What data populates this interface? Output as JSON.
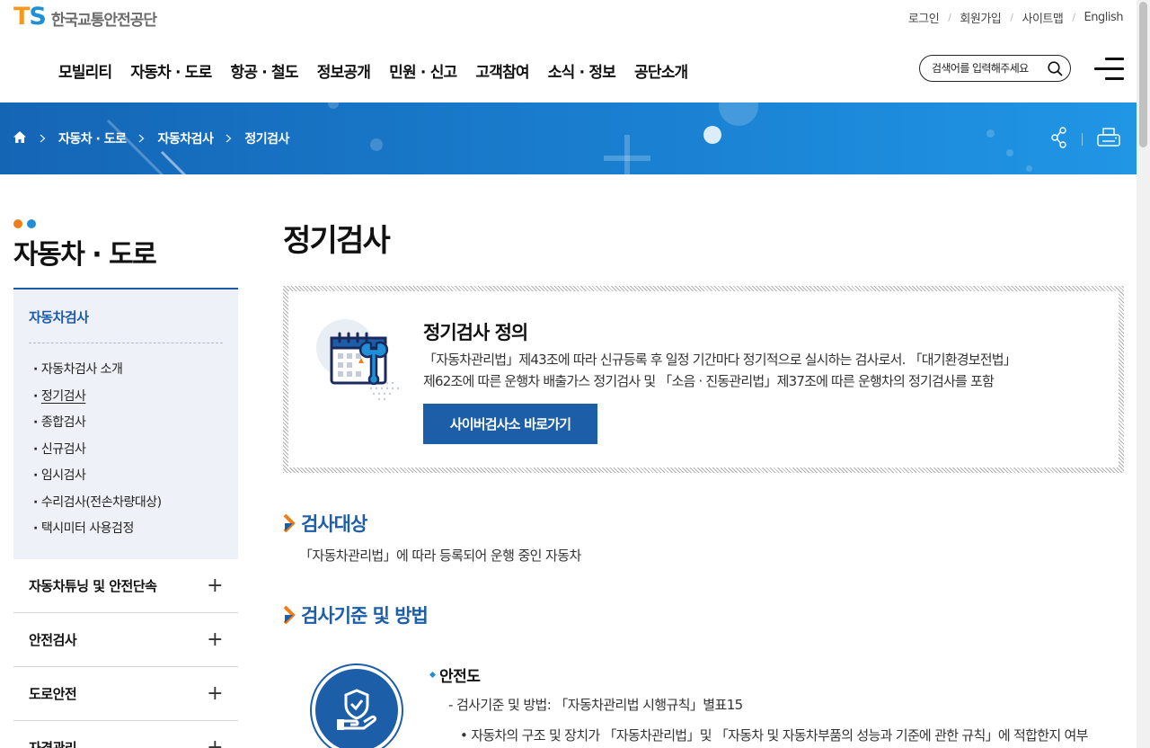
{
  "header": {
    "logo_mark_t": "T",
    "logo_mark_s": "S",
    "logo_text": "한국교통안전공단",
    "util_links": [
      "로그인",
      "회원가입",
      "사이트맵",
      "English"
    ],
    "gnb": [
      "모빌리티",
      "자동차 · 도로",
      "항공 · 철도",
      "정보공개",
      "민원 · 신고",
      "고객참여",
      "소식 · 정보",
      "공단소개"
    ],
    "search_placeholder": "검색어를 입력해주세요"
  },
  "breadcrumb": {
    "items": [
      "자동차 · 도로",
      "자동차검사",
      "정기검사"
    ]
  },
  "sidebar": {
    "title": "자동차 · 도로",
    "section": "자동차검사",
    "sub_items": [
      "자동차검사 소개",
      "정기검사",
      "종합검사",
      "신규검사",
      "임시검사",
      "수리검사(전손차량대상)",
      "택시미터 사용검정"
    ],
    "active_index": 1,
    "menu": [
      "자동차튜닝 및 안전단속",
      "안전검사",
      "도로안전",
      "자격관리"
    ]
  },
  "content": {
    "page_title": "정기검사",
    "definition": {
      "title": "정기검사 정의",
      "desc_line1": "「자동차관리법」제43조에 따라 신규등록 후 일정 기간마다 정기적으로 실시하는 검사로서. 「대기환경보전법」",
      "desc_line2": "제62조에 따른 운행차 배출가스 정기검사 및 「소음 · 진동관리법」제37조에 따른 운행차의 정기검사를 포함",
      "button": "사이버검사소 바로가기"
    },
    "target": {
      "heading": "검사대상",
      "text": "「자동차관리법」에 따라 등록되어 운행 중인 자동차"
    },
    "standard": {
      "heading": "검사기준 및 방법",
      "sub_heading": "안전도",
      "line1": "- 검사기준 및 방법: 「자동차관리법 시행규칙」별표15",
      "line2": "• 자동차의 구조 및 장치가 「자동차관리법」및 「자동차 및 자동차부품의 성능과 기준에 관한 규칙」에 적합한지 여부"
    }
  },
  "colors": {
    "brand_blue": "#1d5ea9",
    "band_blue": "#1a7fd0",
    "logo_orange": "#f39a1e",
    "logo_blue": "#1f8fd6",
    "dot_orange": "#ef7d1a",
    "dot_blue": "#1f8fd6"
  },
  "icons": [
    "home-icon",
    "chevron-right-icon",
    "share-icon",
    "print-icon",
    "search-icon",
    "hamburger-icon",
    "calendar-wrench-icon",
    "shield-hand-icon",
    "plus-icon"
  ]
}
